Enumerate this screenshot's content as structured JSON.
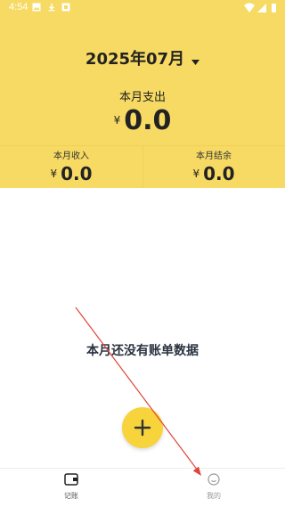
{
  "status_bar": {
    "time": "4:54"
  },
  "header": {
    "month": "2025年07月",
    "expense_label": "本月支出",
    "currency_symbol": "¥",
    "expense_value": "0.0",
    "income_label": "本月收入",
    "income_value": "0.0",
    "balance_label": "本月结余",
    "balance_value": "0.0"
  },
  "empty_state": {
    "message": "本月还没有账单数据"
  },
  "bottom_nav": {
    "items": [
      {
        "label": "记账",
        "icon": "ledger-icon"
      },
      {
        "label": "我的",
        "icon": "smiley-icon"
      }
    ]
  },
  "colors": {
    "accent": "#F7DA63",
    "fab": "#F7D33C",
    "arrow": "#E0453A"
  }
}
